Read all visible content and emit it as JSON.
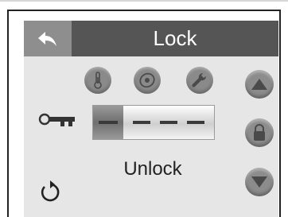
{
  "header": {
    "back_icon": "back-arrow-icon",
    "title": "Lock"
  },
  "top_icons": [
    "thermometer-icon",
    "disc-icon",
    "wrench-icon"
  ],
  "side_buttons": [
    "up-arrow-icon",
    "padlock-icon",
    "down-arrow-icon"
  ],
  "key_icon": "key-icon",
  "code": {
    "digits": [
      "-",
      "-",
      "-",
      "-"
    ]
  },
  "status": "Unlock",
  "refresh_icon": "refresh-icon",
  "colors": {
    "title_bar": "#555555",
    "back_button": "#8e8e8e",
    "panel": "#e6e6e6",
    "button": "#8a8a8a"
  }
}
